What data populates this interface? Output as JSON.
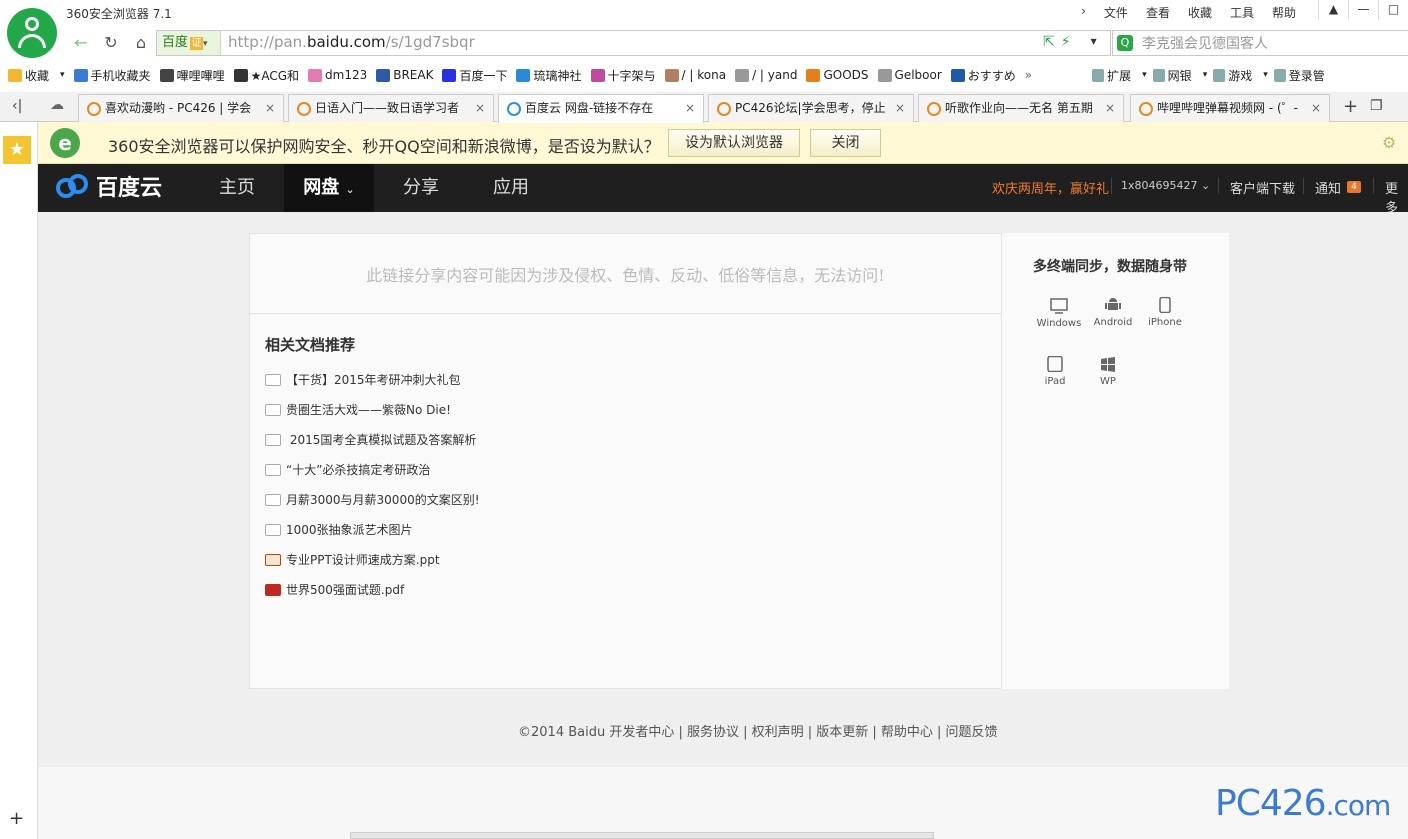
{
  "browser": {
    "title": "360安全浏览器 7.1",
    "menus": [
      "文件",
      "查看",
      "收藏",
      "工具",
      "帮助"
    ],
    "window_buttons": [
      "▲",
      "—",
      "□"
    ],
    "site_label": "百度",
    "cert_label": "证",
    "url_prefix": "http://pan.",
    "url_domain": "baidu.com",
    "url_path": "/s/1gd7sbqr",
    "search_placeholder": "李克强会见德国客人"
  },
  "bookmarks": {
    "items": [
      {
        "label": "收藏",
        "icon": "star-icon",
        "color": "#f2b632"
      },
      {
        "label": "手机收藏夹",
        "icon": "phone-icon",
        "color": "#3a7bd5"
      },
      {
        "label": "嗶哩嗶哩",
        "icon": "tv-icon",
        "color": "#444444"
      },
      {
        "label": "★ACG和",
        "icon": "acg-icon",
        "color": "#333333"
      },
      {
        "label": "dm123",
        "icon": "dm123-icon",
        "color": "#e37ab0"
      },
      {
        "label": "BREAK",
        "icon": "break-icon",
        "color": "#2b5aa8"
      },
      {
        "label": "百度一下",
        "icon": "baidu-paw-icon",
        "color": "#2932e1"
      },
      {
        "label": "琉璃神社",
        "icon": "h-icon",
        "color": "#2a8ad8"
      },
      {
        "label": "十字架与",
        "icon": "ku-icon",
        "color": "#c04aa0"
      },
      {
        "label": "/ | kona",
        "icon": "avatar-icon",
        "color": "#b08060"
      },
      {
        "label": "/ | yand",
        "icon": "page-icon",
        "color": "#999999"
      },
      {
        "label": "GOODS",
        "icon": "goods-icon",
        "color": "#e57f1a"
      },
      {
        "label": "Gelboor",
        "icon": "page-icon",
        "color": "#999999"
      },
      {
        "label": "おすすめ",
        "icon": "p-icon",
        "color": "#1e5aa8"
      }
    ],
    "overflow": "»",
    "right": [
      {
        "label": "扩展",
        "icon": "grid-icon"
      },
      {
        "label": "网银",
        "icon": "bank-icon"
      },
      {
        "label": "游戏",
        "icon": "gamepad-icon"
      },
      {
        "label": "登录管",
        "icon": "key-icon"
      }
    ]
  },
  "tabs": [
    {
      "label": "喜欢动漫哟 - PC426 | 学会",
      "active": false
    },
    {
      "label": "日语入门——致日语学习者",
      "active": false
    },
    {
      "label": "百度云 网盘-链接不存在",
      "active": true
    },
    {
      "label": "PC426论坛|学会思考，停止",
      "active": false
    },
    {
      "label": "听歌作业向——无名 第五期",
      "active": false
    },
    {
      "label": "哔哩哔哩弹幕视频网 - (゜-",
      "active": false
    }
  ],
  "infobar": {
    "text": "360安全浏览器可以保护网购安全、秒开QQ空间和新浪微博，是否设为默认？",
    "set_default": "设为默认浏览器",
    "close": "关闭"
  },
  "baidu": {
    "logo_text": "百度云",
    "nav": [
      {
        "label": "主页",
        "active": false
      },
      {
        "label": "网盘",
        "active": true
      },
      {
        "label": "分享",
        "active": false
      },
      {
        "label": "应用",
        "active": false
      }
    ],
    "promo": "欢庆两周年，赢好礼",
    "username": "1x804695427",
    "client_download": "客户端下载",
    "notice": "通知",
    "notice_count": "4",
    "more": "更多"
  },
  "main": {
    "error_message": "此链接分享内容可能因为涉及侵权、色情、反动、低俗等信息，无法访问!",
    "related_title": "相关文档推荐",
    "docs": [
      {
        "label": "【干货】2015年考研冲刺大礼包",
        "type": "doc"
      },
      {
        "label": "贵圈生活大戏——紫薇No Die!",
        "type": "doc"
      },
      {
        "label": " 2015国考全真模拟试题及答案解析",
        "type": "doc"
      },
      {
        "label": "“十大”必杀技搞定考研政治",
        "type": "doc"
      },
      {
        "label": "月薪3000与月薪30000的文案区别!",
        "type": "doc"
      },
      {
        "label": "1000张抽象派艺术图片",
        "type": "doc"
      },
      {
        "label": "专业PPT设计师速成方案.ppt",
        "type": "ppt"
      },
      {
        "label": "世界500强面试题.pdf",
        "type": "pdf"
      }
    ],
    "sync_title": "多终端同步，数据随身带",
    "devices": [
      "Windows",
      "Android",
      "iPhone",
      "iPad",
      "WP"
    ]
  },
  "footer": {
    "copyright": "©2014 Baidu 开发者中心 | 服务协议 | 权利声明 | 版本更新 | 帮助中心 | 问题反馈"
  },
  "watermark": "PC426.com"
}
